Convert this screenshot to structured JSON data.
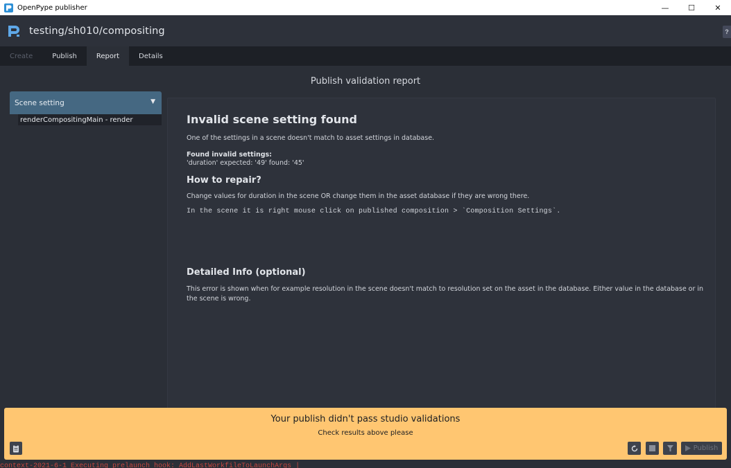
{
  "window": {
    "title": "OpenPype publisher",
    "minimize": "—",
    "maximize": "☐",
    "close": "✕"
  },
  "header": {
    "context": "testing/sh010/compositing",
    "help": "?"
  },
  "tabs": [
    {
      "label": "Create",
      "state": "disabled"
    },
    {
      "label": "Publish",
      "state": "normal"
    },
    {
      "label": "Report",
      "state": "active"
    },
    {
      "label": "Details",
      "state": "normal"
    }
  ],
  "report": {
    "title": "Publish validation report"
  },
  "left_panel": {
    "group_label": "Scene setting",
    "instance_label": "renderCompositingMain - render"
  },
  "details": {
    "heading": "Invalid scene setting found",
    "description": "One of the settings in a scene doesn't match to asset settings in database.",
    "found_label": "Found invalid settings:",
    "found_value": "'duration' expected: '49' found: '45'",
    "repair_heading": "How to repair?",
    "repair_text": "Change values for duration in the scene OR change them in the asset database if they are wrong there.",
    "repair_code": "In the scene it is right mouse click on published composition > `Composition Settings`.",
    "detailed_heading": "Detailed Info (optional)",
    "detailed_text": "This error is shown when for example resolution in the scene doesn't match to resolution set on the asset in the database. Either value in the database or in the scene is wrong."
  },
  "overlay": {
    "title": "Your publish didn't pass studio validations",
    "subtitle": "Check results above please",
    "publish_label": "Publish"
  },
  "log": {
    "text": "context-2021-6-1  Executing prelaunch hook: AddLastWorkfileToLaunchArgs  |"
  },
  "colors": {
    "accent": "#456882",
    "warning": "#ffc671",
    "background": "#2b2f37",
    "log_error": "#c4463f"
  }
}
